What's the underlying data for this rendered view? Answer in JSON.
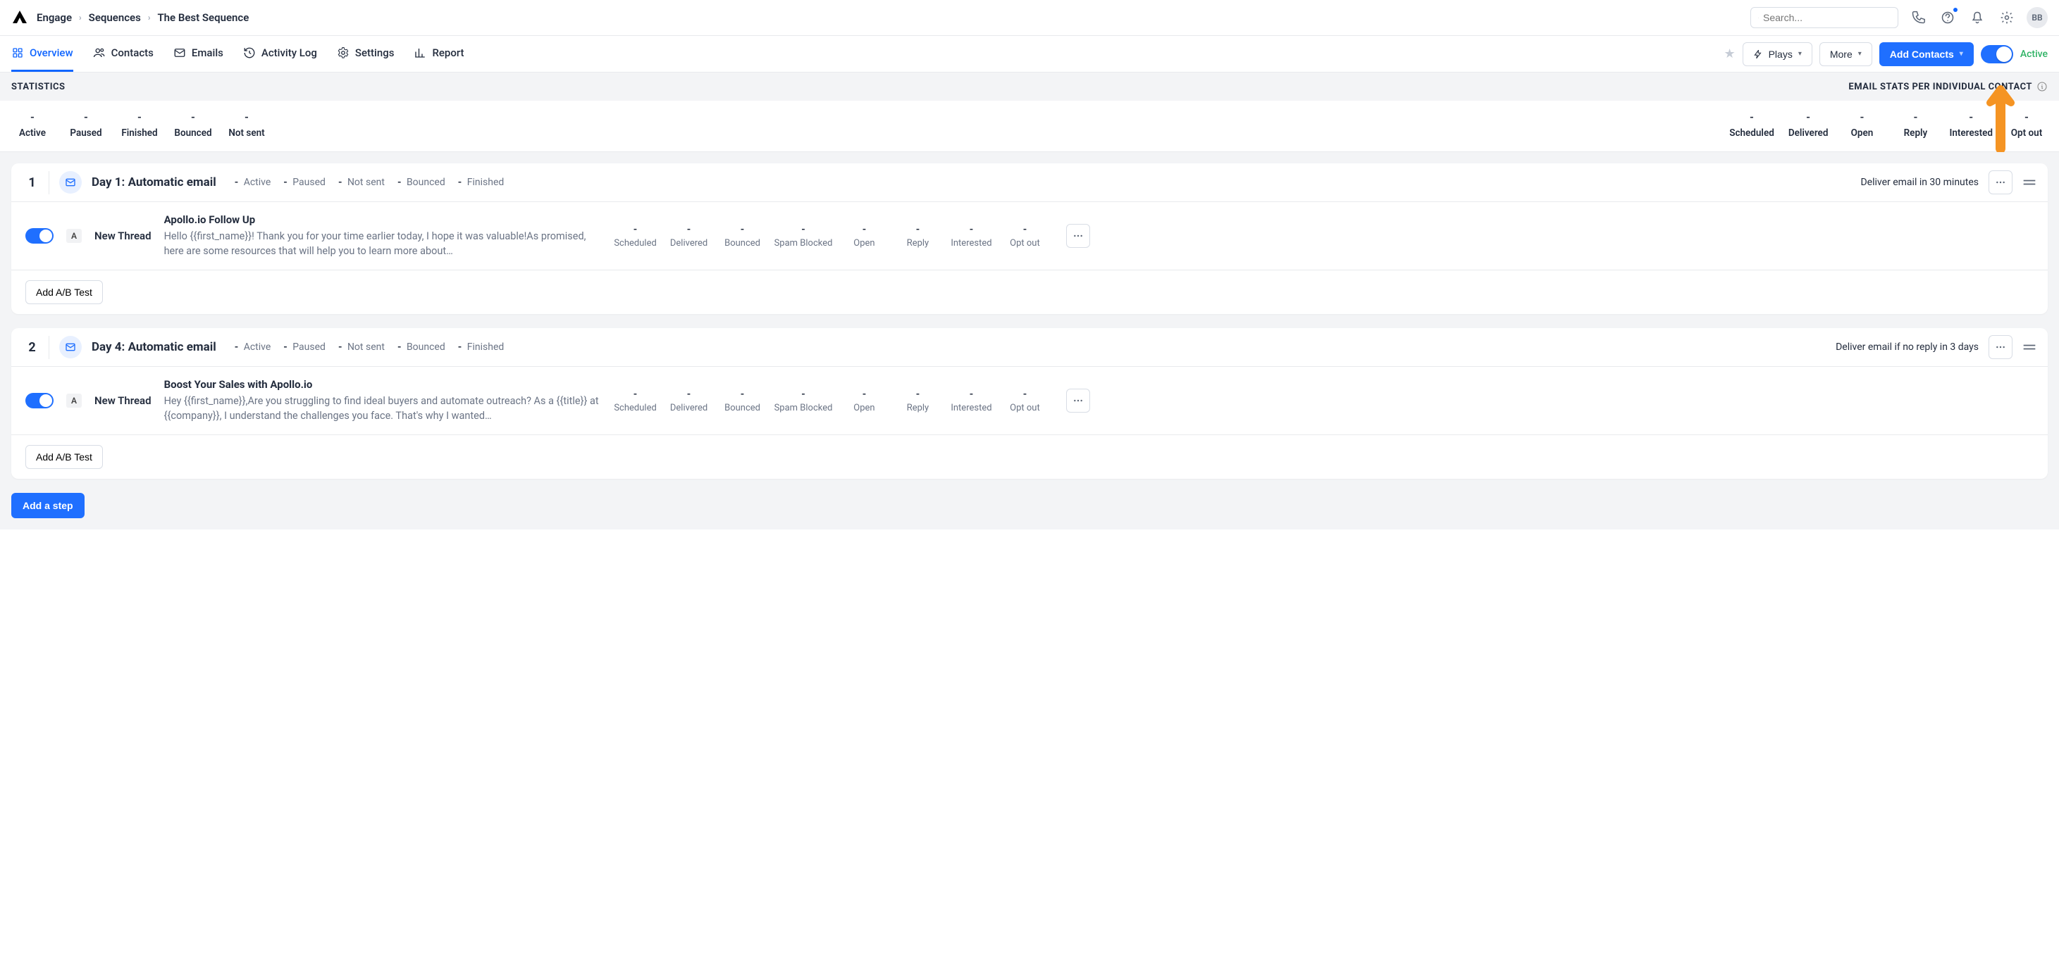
{
  "header": {
    "breadcrumbs": [
      "Engage",
      "Sequences",
      "The Best Sequence"
    ],
    "search_placeholder": "Search...",
    "avatar_initials": "BB"
  },
  "tabs": {
    "items": [
      {
        "label": "Overview",
        "active": true
      },
      {
        "label": "Contacts"
      },
      {
        "label": "Emails"
      },
      {
        "label": "Activity Log"
      },
      {
        "label": "Settings"
      },
      {
        "label": "Report"
      }
    ],
    "plays_label": "Plays",
    "more_label": "More",
    "add_contacts_label": "Add Contacts",
    "active_label": "Active"
  },
  "stats_bar": {
    "left": "STATISTICS",
    "right": "EMAIL STATS PER INDIVIDUAL CONTACT"
  },
  "stats_left": [
    {
      "val": "-",
      "lbl": "Active"
    },
    {
      "val": "-",
      "lbl": "Paused"
    },
    {
      "val": "-",
      "lbl": "Finished"
    },
    {
      "val": "-",
      "lbl": "Bounced"
    },
    {
      "val": "-",
      "lbl": "Not sent"
    }
  ],
  "stats_right": [
    {
      "val": "-",
      "lbl": "Scheduled"
    },
    {
      "val": "-",
      "lbl": "Delivered"
    },
    {
      "val": "-",
      "lbl": "Open"
    },
    {
      "val": "-",
      "lbl": "Reply"
    },
    {
      "val": "-",
      "lbl": "Interested"
    },
    {
      "val": "-",
      "lbl": "Opt out"
    }
  ],
  "steps": [
    {
      "num": "1",
      "title": "Day 1: Automatic email",
      "mini_stats": [
        {
          "v": "-",
          "l": "Active"
        },
        {
          "v": "-",
          "l": "Paused"
        },
        {
          "v": "-",
          "l": "Not sent"
        },
        {
          "v": "-",
          "l": "Bounced"
        },
        {
          "v": "-",
          "l": "Finished"
        }
      ],
      "deliver": "Deliver email in 30 minutes",
      "thread_badge": "A",
      "thread_label": "New Thread",
      "subject": "Apollo.io Follow Up",
      "preview": "Hello {{first_name}}! Thank you for your time earlier today, I hope it was valuable!As promised, here are some resources that will help you to learn more about…",
      "body_stats": [
        {
          "v": "-",
          "l": "Scheduled"
        },
        {
          "v": "-",
          "l": "Delivered"
        },
        {
          "v": "-",
          "l": "Bounced"
        },
        {
          "v": "-",
          "l": "Spam Blocked"
        },
        {
          "v": "-",
          "l": "Open"
        },
        {
          "v": "-",
          "l": "Reply"
        },
        {
          "v": "-",
          "l": "Interested"
        },
        {
          "v": "-",
          "l": "Opt out"
        }
      ],
      "ab_label": "Add A/B Test"
    },
    {
      "num": "2",
      "title": "Day 4: Automatic email",
      "mini_stats": [
        {
          "v": "-",
          "l": "Active"
        },
        {
          "v": "-",
          "l": "Paused"
        },
        {
          "v": "-",
          "l": "Not sent"
        },
        {
          "v": "-",
          "l": "Bounced"
        },
        {
          "v": "-",
          "l": "Finished"
        }
      ],
      "deliver": "Deliver email if no reply in 3 days",
      "thread_badge": "A",
      "thread_label": "New Thread",
      "subject": "Boost Your Sales with Apollo.io",
      "preview": "Hey {{first_name}},Are you struggling to find ideal buyers and automate outreach? As a {{title}} at {{company}}, I understand the challenges you face. That's why I wanted…",
      "body_stats": [
        {
          "v": "-",
          "l": "Scheduled"
        },
        {
          "v": "-",
          "l": "Delivered"
        },
        {
          "v": "-",
          "l": "Bounced"
        },
        {
          "v": "-",
          "l": "Spam Blocked"
        },
        {
          "v": "-",
          "l": "Open"
        },
        {
          "v": "-",
          "l": "Reply"
        },
        {
          "v": "-",
          "l": "Interested"
        },
        {
          "v": "-",
          "l": "Opt out"
        }
      ],
      "ab_label": "Add A/B Test"
    }
  ],
  "add_step_label": "Add a step"
}
